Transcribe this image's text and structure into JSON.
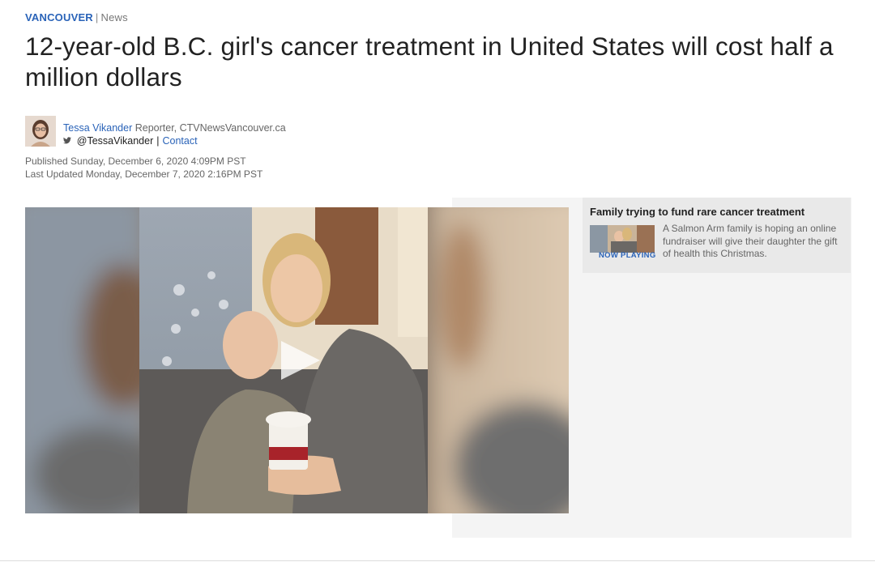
{
  "breadcrumb": {
    "section": "VANCOUVER",
    "separator": "|",
    "subsection": "News"
  },
  "article": {
    "headline": "12-year-old B.C. girl's cancer treatment in United States will cost half a million dollars",
    "author": {
      "name": "Tessa Vikander",
      "role": "Reporter, CTVNewsVancouver.ca",
      "twitter_handle": "@TessaVikander",
      "separator": "|",
      "contact_label": "Contact"
    },
    "published": "Published Sunday, December 6, 2020 4:09PM PST",
    "updated": "Last Updated Monday, December 7, 2020 2:16PM PST"
  },
  "video": {
    "play_icon": "play-icon"
  },
  "playlist": {
    "items": [
      {
        "title": "Family trying to fund rare cancer treatment",
        "status": "NOW PLAYING",
        "description": "A Salmon Arm family is hoping an online fundraiser will give their daughter the gift of health this Christmas."
      }
    ]
  },
  "colors": {
    "link": "#2a63b8",
    "panel": "#f4f4f4",
    "playlist_item": "#e9e9e9"
  }
}
